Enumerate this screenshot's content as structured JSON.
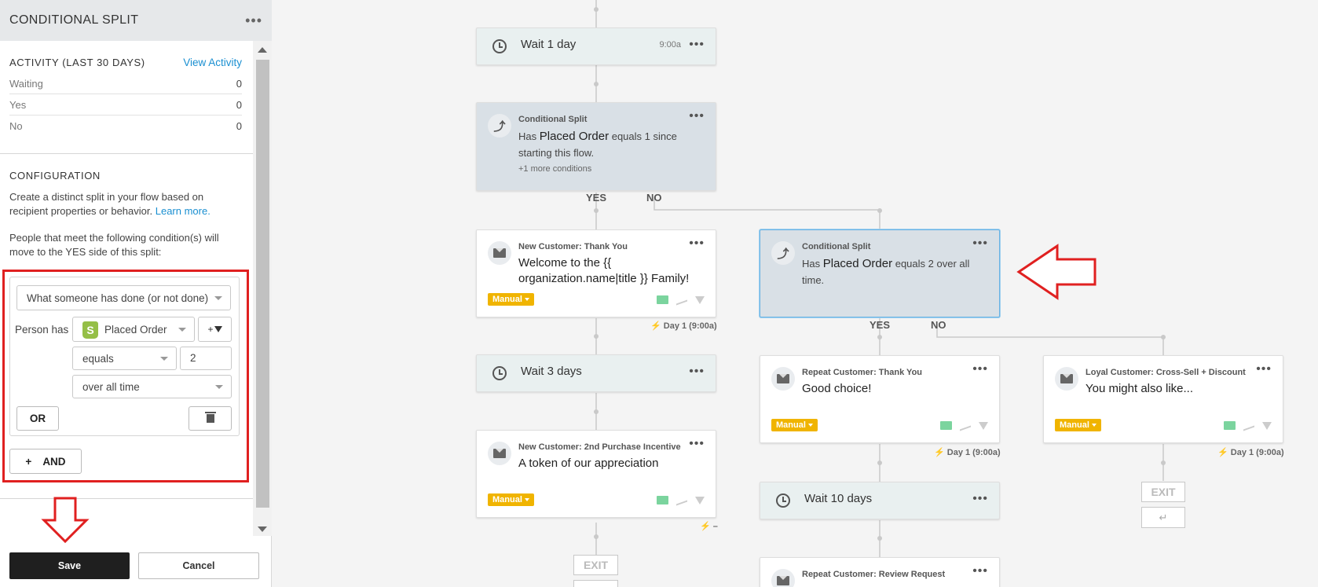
{
  "panel": {
    "title": "CONDITIONAL SPLIT",
    "menu_icon": "more-dots-icon",
    "activity": {
      "heading": "ACTIVITY (LAST 30 DAYS)",
      "link": "View Activity",
      "rows": [
        {
          "label": "Waiting",
          "value": "0"
        },
        {
          "label": "Yes",
          "value": "0"
        },
        {
          "label": "No",
          "value": "0"
        }
      ]
    },
    "configuration": {
      "heading": "CONFIGURATION",
      "description": "Create a distinct split in your flow based on recipient properties or behavior.",
      "learn_more": "Learn more.",
      "criteria_text": "People that meet the following condition(s) will move to the YES side of this split:",
      "condition_type": "What someone has done (or not done)",
      "person_has_label": "Person has",
      "metric": "Placed Order",
      "filter_label": "+",
      "operator": "equals",
      "value": "2",
      "timeframe": "over all time",
      "or_label": "OR",
      "and_label": "AND"
    },
    "footer": {
      "save": "Save",
      "cancel": "Cancel"
    },
    "highlight_color": "#e02020"
  },
  "flow": {
    "wait_1": {
      "label": "Wait 1 day",
      "time": "9:00a"
    },
    "split_1": {
      "kind": "Conditional Split",
      "prefix": "Has ",
      "metric": "Placed Order",
      "rest": " equals 1 since starting this flow.",
      "more": "+1 more conditions",
      "yes": "YES",
      "no": "NO"
    },
    "email_new_thanks": {
      "kind": "New Customer: Thank You",
      "title": "Welcome to the {{ organization.name|title }} Family!",
      "badge": "Manual",
      "delay": "Day 1 (9:00a)"
    },
    "wait_3": {
      "label": "Wait 3 days"
    },
    "email_incentive": {
      "kind": "New Customer: 2nd Purchase Incentive",
      "title": "A token of our appreciation",
      "badge": "Manual",
      "delay": "–"
    },
    "exit_left": "EXIT",
    "split_2": {
      "kind": "Conditional Split",
      "prefix": "Has ",
      "metric": "Placed Order",
      "rest": " equals 2 over all time.",
      "yes": "YES",
      "no": "NO"
    },
    "email_repeat_thanks": {
      "kind": "Repeat Customer: Thank You",
      "title": "Good choice!",
      "badge": "Manual",
      "delay": "Day 1 (9:00a)"
    },
    "email_loyal": {
      "kind": "Loyal Customer: Cross-Sell + Discount",
      "title": "You might also like...",
      "badge": "Manual",
      "delay": "Day 1 (9:00a)"
    },
    "exit_right": "EXIT",
    "wait_10": {
      "label": "Wait 10 days"
    },
    "email_review": {
      "kind": "Repeat Customer: Review Request"
    },
    "badge_color": "#f0b400",
    "accent": "#1a8fd1"
  }
}
